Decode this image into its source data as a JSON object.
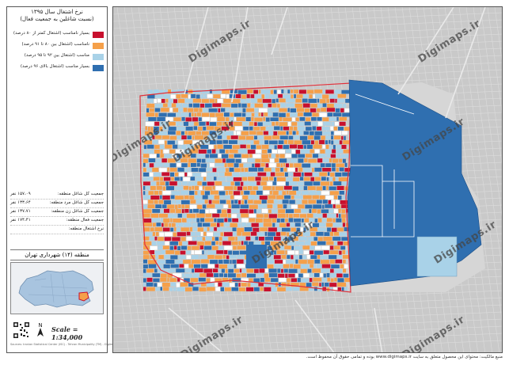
{
  "title": {
    "line1": "نرخ اشتغال سال ۱۳۹۵",
    "line2": "(نسبت شاغلین به جمعیت فعال)"
  },
  "legend": {
    "items": [
      {
        "label": "بسیار نامناسب (اشتغال کمتر از ۸۰ درصد)",
        "color": "#c8102e"
      },
      {
        "label": "نامناسب (اشتغال بین ۸۰ تا ۹۱ درصد)",
        "color": "#f5a04a"
      },
      {
        "label": "مناسب (اشتغال بین ۹۲ تا ۹۵ درصد)",
        "color": "#a9d2e8"
      },
      {
        "label": "بسیار مناسب (اشتغال بالای ۹۶ درصد)",
        "color": "#2f6fb0"
      }
    ]
  },
  "stats": [
    {
      "label": "جمعیت کل شاغل منطقه:",
      "value": "۱۵۷،۰۹ نفر"
    },
    {
      "label": "جمعیت کل شاغل مرد منطقه:",
      "value": "۱۳۳،۶۴ نفر"
    },
    {
      "label": "جمعیت کل شاغل زن منطقه:",
      "value": "۱۳۷،۷۱ نفر"
    },
    {
      "label": "جمعیت فعال منطقه:",
      "value": "۱۷۴،۴۱ نفر"
    },
    {
      "label": "نرخ اشتغال منطقه:",
      "value": ""
    }
  ],
  "district_label": "منطقه (۱۴) شهرداری تهران",
  "scale": "Scale = 1:34,000",
  "credit": "Sources: Iranian Statistical Center (ISC) - Tehran Municipality (TM) - Digimaps.ir",
  "watermark": "Digimaps.ir",
  "footer": "منبع مالکیت: محتوای این محصول متعلق به سایت www.digimaps.ir بوده و تمامی حقوق آن محفوظ است.",
  "colors": {
    "very_poor": "#c8102e",
    "poor": "#f5a04a",
    "good": "#a9d2e8",
    "very_good": "#2f6fb0",
    "background": "#c9c9c9",
    "boundary": "#e0303a"
  }
}
